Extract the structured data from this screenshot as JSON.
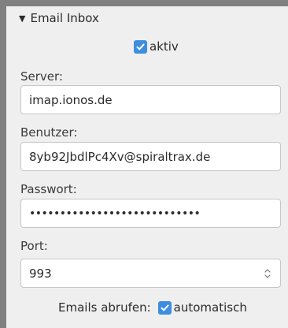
{
  "section": {
    "title": "Email Inbox",
    "collapse_icon": "triangle-down-icon"
  },
  "active": {
    "label": "aktiv",
    "checked": true
  },
  "server": {
    "label": "Server:",
    "value": "imap.ionos.de"
  },
  "user": {
    "label": "Benutzer:",
    "value": "8yb92JbdlPc4Xv@spiraltrax.de"
  },
  "password": {
    "label": "Passwort:",
    "masked_value": "••••••••••••••••••••••••••••"
  },
  "port": {
    "label": "Port:",
    "value": "993",
    "stepper_icon": "spinner-up-down-icon"
  },
  "fetch": {
    "label": "Emails abrufen:",
    "option_label": "automatisch",
    "checked": true
  },
  "colors": {
    "accent": "#3d8ee0",
    "panel_bg": "#efefef",
    "frame": "#808080"
  }
}
